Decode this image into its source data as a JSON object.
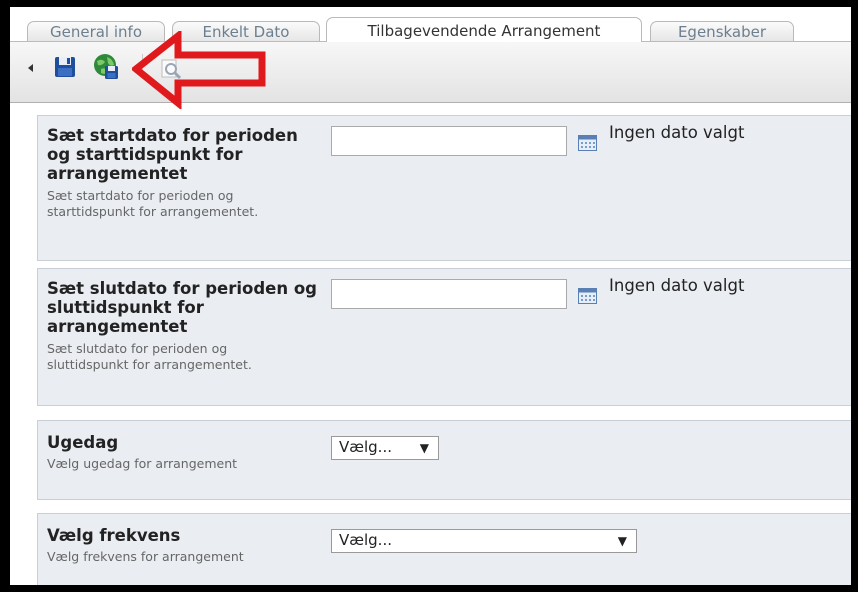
{
  "tabs": [
    {
      "label": "General info",
      "active": false
    },
    {
      "label": "Enkelt Dato",
      "active": false
    },
    {
      "label": "Tilbagevendende Arrangement",
      "active": true
    },
    {
      "label": "Egenskaber",
      "active": false
    }
  ],
  "toolbar": {
    "icons": [
      "collapse-arrow-icon",
      "save-icon",
      "save-and-publish-icon",
      "preview-icon"
    ]
  },
  "fields": {
    "start": {
      "title": "Sæt startdato for perioden og starttidspunkt for arrangementet",
      "description": "Sæt startdato for perioden og starttidspunkt for arrangementet.",
      "value": "",
      "no_date": "Ingen dato valgt"
    },
    "end": {
      "title": "Sæt slutdato for perioden og sluttidspunkt for arrangementet",
      "description": "Sæt slutdato for perioden og sluttidspunkt for arrangementet.",
      "value": "",
      "no_date": "Ingen dato valgt"
    },
    "weekday": {
      "title": "Ugedag",
      "description": "Vælg ugedag for arrangement",
      "selected": "Vælg..."
    },
    "frequency": {
      "title": "Vælg frekvens",
      "description": "Vælg frekvens for arrangement",
      "selected": "Vælg..."
    }
  },
  "colors": {
    "panel_bg": "#eaedf2",
    "annotation_arrow": "#e0191c"
  }
}
